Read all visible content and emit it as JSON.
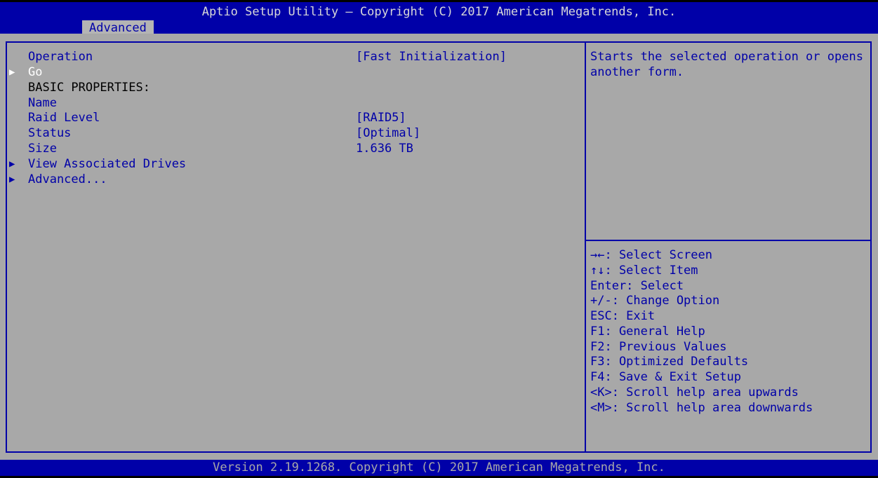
{
  "header": {
    "title": "Aptio Setup Utility – Copyright (C) 2017 American Megatrends, Inc.",
    "active_tab": "Advanced"
  },
  "menu": {
    "operation_label": "Operation",
    "operation_value": "[Fast Initialization]",
    "go_label": "Go",
    "basic_properties_label": "BASIC PROPERTIES:",
    "name_label": "Name",
    "raid_level_label": "Raid Level",
    "raid_level_value": "[RAID5]",
    "status_label": "Status",
    "status_value": "[Optimal]",
    "size_label": "Size",
    "size_value": "1.636 TB",
    "view_drives_label": "View Associated Drives",
    "advanced_label": "Advanced...",
    "submenu_arrow_icon": "triangle-right-icon"
  },
  "help": {
    "text": "Starts the selected operation or opens another form."
  },
  "keys": [
    "→←: Select Screen",
    "↑↓: Select Item",
    "Enter: Select",
    "+/-: Change Option",
    "ESC: Exit",
    "F1: General Help",
    "F2: Previous Values",
    "F3: Optimized Defaults",
    "F4: Save & Exit Setup",
    "<K>: Scroll help area upwards",
    "<M>: Scroll help area downwards"
  ],
  "footer": {
    "text": "Version 2.19.1268. Copyright (C) 2017 American Megatrends, Inc."
  },
  "colors": {
    "bar_blue": "#0000a8",
    "panel_gray": "#a8a8a8",
    "selected_text": "#ffffff",
    "tab_background": "#b4b4b4"
  }
}
